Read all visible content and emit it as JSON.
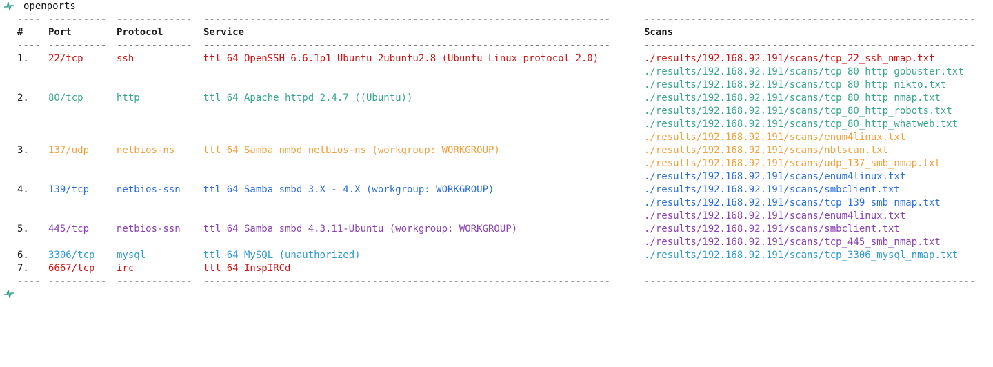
{
  "prompt": {
    "command": "openports"
  },
  "colors": {
    "prompt_icon": "#3aa58f",
    "red": "#cc1414",
    "teal": "#3aa58f",
    "orange": "#f0a03c",
    "blue": "#2a6fd8",
    "purple": "#8a44b0",
    "sky": "#2f9bd0"
  },
  "table": {
    "headers": {
      "num": "#",
      "port": "Port",
      "protocol": "Protocol",
      "service": "Service",
      "scans": "Scans"
    },
    "dashes": {
      "num": "----",
      "port": "----------",
      "protocol": "-------------",
      "service": "----------------------------------------------------------------------",
      "scans": "---------------------------------------------------------"
    },
    "rows": [
      {
        "num": "1.",
        "port": "22/tcp",
        "protocol": "ssh",
        "service": "ttl 64 OpenSSH 6.6.1p1 Ubuntu 2ubuntu2.8 (Ubuntu Linux protocol 2.0)",
        "color": "red",
        "scans": [
          "./results/192.168.92.191/scans/tcp_22_ssh_nmap.txt"
        ]
      },
      {
        "num": "2.",
        "port": "80/tcp",
        "protocol": "http",
        "service": "ttl 64 Apache httpd 2.4.7 ((Ubuntu))",
        "color": "teal",
        "scans": [
          "./results/192.168.92.191/scans/tcp_80_http_gobuster.txt",
          "./results/192.168.92.191/scans/tcp_80_http_nikto.txt",
          "./results/192.168.92.191/scans/tcp_80_http_nmap.txt",
          "./results/192.168.92.191/scans/tcp_80_http_robots.txt",
          "./results/192.168.92.191/scans/tcp_80_http_whatweb.txt"
        ]
      },
      {
        "num": "3.",
        "port": "137/udp",
        "protocol": "netbios-ns",
        "service": "ttl 64 Samba nmbd netbios-ns (workgroup: WORKGROUP)",
        "color": "orange",
        "scans": [
          "./results/192.168.92.191/scans/enum4linux.txt",
          "./results/192.168.92.191/scans/nbtscan.txt",
          "./results/192.168.92.191/scans/udp_137_smb_nmap.txt"
        ]
      },
      {
        "num": "4.",
        "port": "139/tcp",
        "protocol": "netbios-ssn",
        "service": "ttl 64 Samba smbd 3.X - 4.X (workgroup: WORKGROUP)",
        "color": "blue",
        "scans": [
          "./results/192.168.92.191/scans/enum4linux.txt",
          "./results/192.168.92.191/scans/smbclient.txt",
          "./results/192.168.92.191/scans/tcp_139_smb_nmap.txt"
        ]
      },
      {
        "num": "5.",
        "port": "445/tcp",
        "protocol": "netbios-ssn",
        "service": "ttl 64 Samba smbd 4.3.11-Ubuntu (workgroup: WORKGROUP)",
        "color": "purple",
        "scans": [
          "./results/192.168.92.191/scans/enum4linux.txt",
          "./results/192.168.92.191/scans/smbclient.txt",
          "./results/192.168.92.191/scans/tcp_445_smb_nmap.txt"
        ]
      },
      {
        "num": "6.",
        "port": "3306/tcp",
        "protocol": "mysql",
        "service": "ttl 64 MySQL (unauthorized)",
        "color": "sky",
        "scans": [
          "./results/192.168.92.191/scans/tcp_3306_mysql_nmap.txt"
        ]
      },
      {
        "num": "7.",
        "port": "6667/tcp",
        "protocol": "irc",
        "service": "ttl 64 InspIRCd",
        "color": "red",
        "scans": []
      }
    ]
  }
}
